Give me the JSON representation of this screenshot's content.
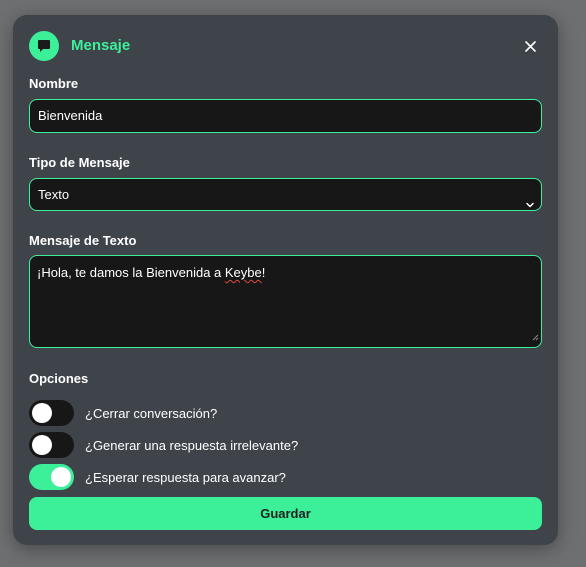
{
  "dialog": {
    "title": "Mensaje",
    "icon": "chat-bubble-icon",
    "close_icon": "close-icon"
  },
  "form": {
    "name_label": "Nombre",
    "name_value": "Bienvenida",
    "type_label": "Tipo de Mensaje",
    "type_value": "Texto",
    "text_label": "Mensaje de Texto",
    "text_before": "¡Hola, te damos la Bienvenida a ",
    "text_misspelled": "Keybe",
    "text_after": "!"
  },
  "options": {
    "label": "Opciones",
    "toggles": [
      {
        "label": "¿Cerrar conversación?",
        "on": false
      },
      {
        "label": "¿Generar una respuesta irrelevante?",
        "on": false
      },
      {
        "label": "¿Esperar respuesta para avanzar?",
        "on": true
      }
    ]
  },
  "actions": {
    "save_label": "Guardar"
  },
  "colors": {
    "accent": "#3cf09a",
    "panel": "#3f444b",
    "field_bg": "#171717",
    "backdrop": "#6e6f71"
  }
}
